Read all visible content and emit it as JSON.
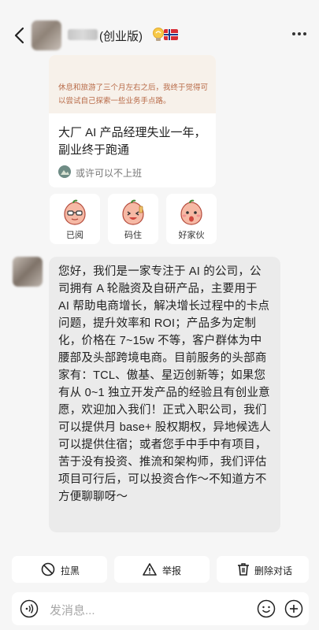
{
  "header": {
    "title_suffix": "(创业版)",
    "back_icon": "chevron-left-icon",
    "more_icon": "more-dots-icon",
    "badges": [
      "bulb-emoji-icon",
      "norway-flag-icon"
    ]
  },
  "article": {
    "quote": "休息和旅游了三个月左右之后，我终于觉得可以尝试自己探索一些业务手点路。",
    "title": "大厂 AI 产品经理失业一年，副业终于跑通",
    "author": "或许可以不上班"
  },
  "reactions": [
    {
      "label": "已阅",
      "icon": "peach-glasses-icon"
    },
    {
      "label": "码住",
      "icon": "peach-cheer-icon"
    },
    {
      "label": "好家伙",
      "icon": "peach-wow-icon"
    }
  ],
  "message": {
    "text": "您好，我们是一家专注于 AI 的公司，公司拥有 A 轮融资及自研产品，主要用于 AI 帮助电商增长，解决增长过程中的卡点问题，提升效率和 ROI；产品多为定制化，价格在 7~15w 不等，客户群体为中腰部及头部跨境电商。目前服务的头部商家有：TCL、傲基、星迈创新等；如果您有从 0~1 独立开发产品的经验且有创业意愿，欢迎加入我们！正式入职公司，我们可以提供月 base+ 股权期权，异地候选人可以提供住宿；或者您手中手中有项目，苦于没有投资、推流和架构师，我们评估项目可行后，可以投资合作～不知道方不方便聊聊呀～"
  },
  "actions": {
    "block": "拉黑",
    "report": "举报",
    "delete": "删除对话"
  },
  "input": {
    "placeholder": "发消息..."
  },
  "colors": {
    "background": "#f6f6f6",
    "bubble": "#ebebeb",
    "quote_text": "#b86a47"
  }
}
